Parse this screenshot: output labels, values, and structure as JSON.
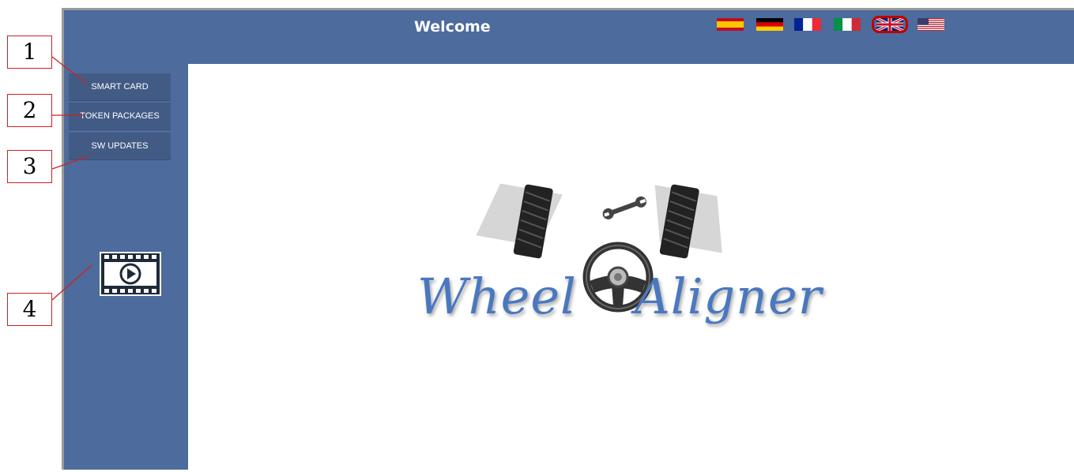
{
  "header": {
    "title": "Welcome"
  },
  "languages": [
    {
      "code": "es",
      "icon": "spain-flag-icon"
    },
    {
      "code": "de",
      "icon": "germany-flag-icon"
    },
    {
      "code": "fr",
      "icon": "france-flag-icon"
    },
    {
      "code": "it",
      "icon": "italy-flag-icon"
    },
    {
      "code": "en-gb",
      "icon": "uk-flag-icon",
      "selected": true
    },
    {
      "code": "en-us",
      "icon": "usa-flag-icon"
    }
  ],
  "sidebar": {
    "buttons": [
      {
        "label": "SMART CARD"
      },
      {
        "label": "TOKEN PACKAGES"
      },
      {
        "label": "SW UPDATES"
      }
    ],
    "video_icon": "video-play-icon"
  },
  "logo": {
    "word1": "Wheel",
    "word2": "Aligner"
  },
  "callouts": [
    "1",
    "2",
    "3",
    "4"
  ],
  "colors": {
    "frame": "#4d6b9c",
    "button": "#425b85",
    "callout_border": "#d02020",
    "logo_text": "#4a78c0"
  }
}
